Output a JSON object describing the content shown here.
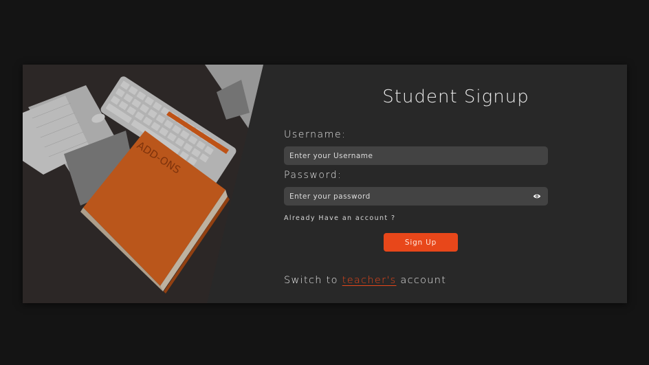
{
  "form": {
    "title": "Student Signup",
    "username_label": "Username:",
    "username_placeholder": "Enter your Username",
    "password_label": "Password:",
    "password_placeholder": "Enter your password",
    "already_text": "Already Have an account ?",
    "signup_button": "Sign Up",
    "switch_prefix": "Switch to ",
    "switch_link": "teacher's",
    "switch_suffix": " account"
  },
  "photo": {
    "book_label": "ADD-ONS"
  },
  "icons": {
    "password_toggle": "eye-icon"
  },
  "colors": {
    "page_background": "#141414",
    "card_background": "#282828",
    "input_background": "#434343",
    "accent": "#e8471a"
  }
}
